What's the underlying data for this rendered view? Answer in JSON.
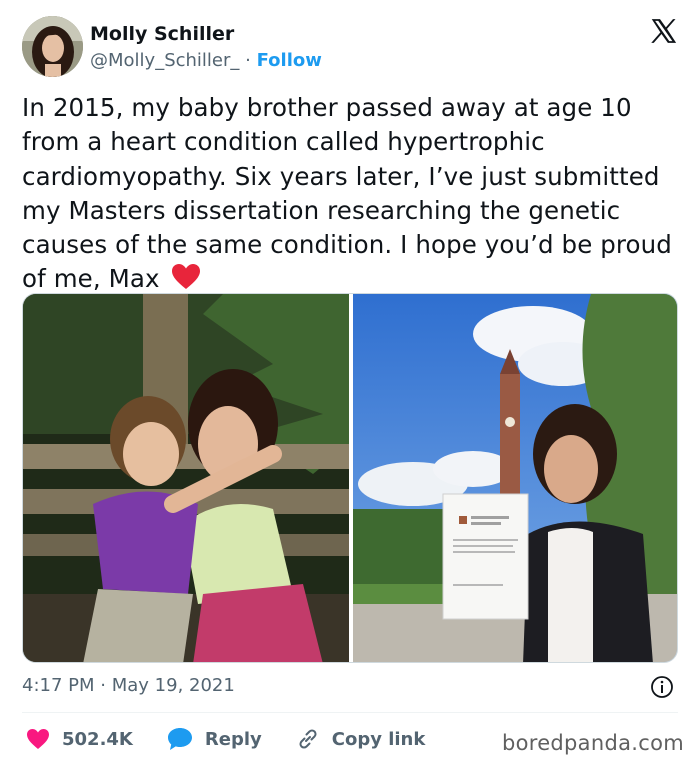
{
  "author": {
    "name": "Molly Schiller",
    "handle": "@Molly_Schiller_",
    "separator": "·",
    "follow_label": "Follow"
  },
  "icons": {
    "logo": "x-logo-icon",
    "heart_emoji": "red-heart-emoji",
    "info": "info-icon",
    "like": "heart-icon",
    "reply": "speech-bubble-icon",
    "copy": "link-icon"
  },
  "tweet": {
    "text": "In 2015, my baby brother passed away at age 10 from a heart condition called hypertrophic cardiomyopathy. Six years later, I’ve just submitted my Masters dissertation researching the genetic causes of the same condition. I hope you’d be proud of me, Max"
  },
  "photos": {
    "left_alt": "Molly hugging her little brother outdoors",
    "right_alt": "Molly holding her dissertation in front of a clock tower"
  },
  "meta": {
    "time": "4:17 PM",
    "separator": "·",
    "date": "May 19, 2021"
  },
  "actions": {
    "likes": "502.4K",
    "reply_label": "Reply",
    "copy_label": "Copy link"
  },
  "watermark": "boredpanda.com",
  "colors": {
    "accent": "#1d9bf0",
    "like": "#f91880",
    "reply": "#1d9bf0",
    "text": "#0f1419",
    "muted": "#536471"
  }
}
